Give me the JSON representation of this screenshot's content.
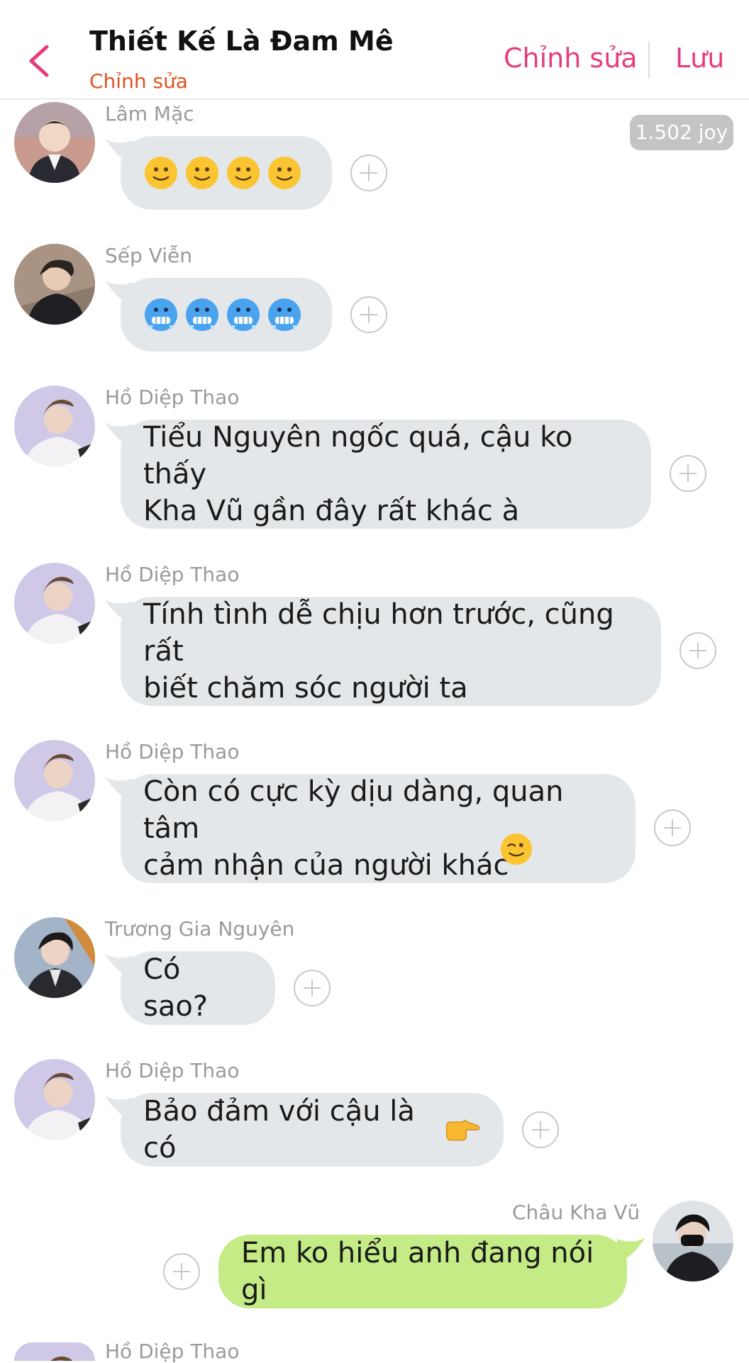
{
  "header": {
    "title": "Thiết Kế Là Đam Mê",
    "subtitle": "Chỉnh sửa",
    "edit_label": "Chỉnh sửa",
    "save_label": "Lưu",
    "back_icon": "chevron-left-icon",
    "accent_color": "#e63d7e",
    "subtitle_color": "#e0531f"
  },
  "badge": {
    "text": "1.502 joy"
  },
  "colors": {
    "bubble_other": "#e4e7ea",
    "bubble_self": "#c4eb85",
    "sender_name": "#9a9a9a"
  },
  "messages": [
    {
      "sender": "Lâm Mặc",
      "text": "",
      "emoji": "slightly-smiling-face-icon",
      "emoji_count": 4
    },
    {
      "sender": "Sếp Viễn",
      "text": "",
      "emoji": "cold-face-icon",
      "emoji_count": 4
    },
    {
      "sender": "Hồ Diệp Thao",
      "text": "Tiểu Nguyên ngốc quá, cậu ko thấy\nKha Vũ gần đây rất khác à"
    },
    {
      "sender": "Hồ Diệp Thao",
      "text": "Tính tình dễ chịu hơn trước, cũng rất\nbiết chăm sóc người ta"
    },
    {
      "sender": "Hồ Diệp Thao",
      "text": "Còn có cực kỳ dịu dàng, quan tâm\ncảm nhận của người khác",
      "emoji": "winking-face-icon"
    },
    {
      "sender": "Trương Gia Nguyên",
      "text": "Có sao?"
    },
    {
      "sender": "Hồ Diệp Thao",
      "text": "Bảo đảm với cậu là có",
      "emoji": "backhand-index-pointing-right-icon"
    },
    {
      "sender": "Châu Kha Vũ",
      "text": "Em ko hiểu anh đang nói gì",
      "self": true
    },
    {
      "sender": "Hồ Diệp Thao",
      "text": ""
    }
  ]
}
